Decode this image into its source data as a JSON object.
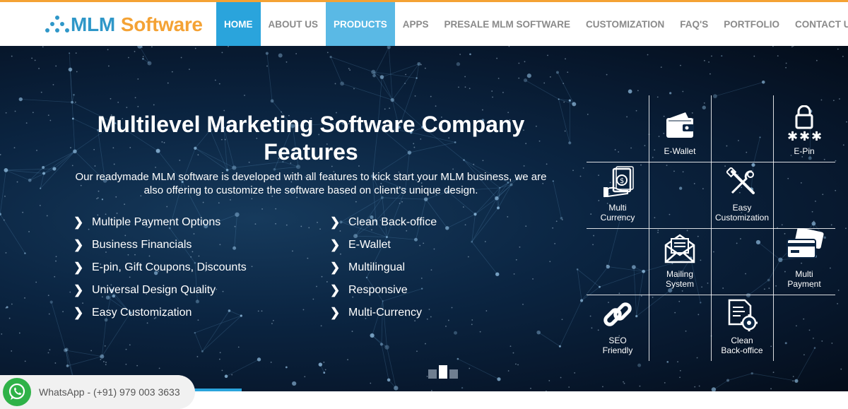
{
  "brand": {
    "part1": "MLM",
    "part2": "Software",
    "primary_color": "#2f97c8",
    "accent_color": "#f4a234"
  },
  "nav": [
    {
      "label": "HOME",
      "state": "active"
    },
    {
      "label": "ABOUT US"
    },
    {
      "label": "PRODUCTS",
      "state": "hover"
    },
    {
      "label": "APPS"
    },
    {
      "label": "PRESALE MLM SOFTWARE"
    },
    {
      "label": "CUSTOMIZATION"
    },
    {
      "label": "FAQ'S"
    },
    {
      "label": "PORTFOLIO"
    },
    {
      "label": "CONTACT US"
    }
  ],
  "hero": {
    "title_line1": "Multilevel Marketing Software Company",
    "title_line2": "Features",
    "subtitle_line1": "Our readymade MLM software is developed with all features to kick start your MLM business, we are",
    "subtitle_line2": "also offering to customize the software based on client's unique design.",
    "features_left": [
      "Multiple Payment Options",
      "Business Financials",
      "E-pin, Gift Coupons, Discounts",
      "Universal Design Quality",
      "Easy Customization"
    ],
    "features_right": [
      "Clean Back-office",
      "E-Wallet",
      "Multilingual",
      "Responsive",
      "Multi-Currency"
    ]
  },
  "grid": {
    "ewallet": {
      "l1": "E-Wallet",
      "icon": "wallet-icon"
    },
    "epin": {
      "l1": "E-Pin",
      "icon": "lock-icon"
    },
    "multicurrency": {
      "l1": "Multi",
      "l2": "Currency",
      "icon": "money-icon"
    },
    "easycustom": {
      "l1": "Easy",
      "l2": "Customization",
      "icon": "tools-icon"
    },
    "mailing": {
      "l1": "Mailing",
      "l2": "System",
      "icon": "mail-icon"
    },
    "multipayment": {
      "l1": "Multi",
      "l2": "Payment",
      "icon": "credit-cards-icon"
    },
    "seo": {
      "l1": "SEO",
      "l2": "Friendly",
      "icon": "link-icon"
    },
    "backoffice": {
      "l1": "Clean",
      "l2": "Back-office",
      "icon": "document-gear-icon"
    }
  },
  "slider": {
    "slides": 3,
    "active_index": 1
  },
  "whatsapp": {
    "label": "WhatsApp - (+91) 979 003 3633",
    "color": "#2fb248"
  }
}
